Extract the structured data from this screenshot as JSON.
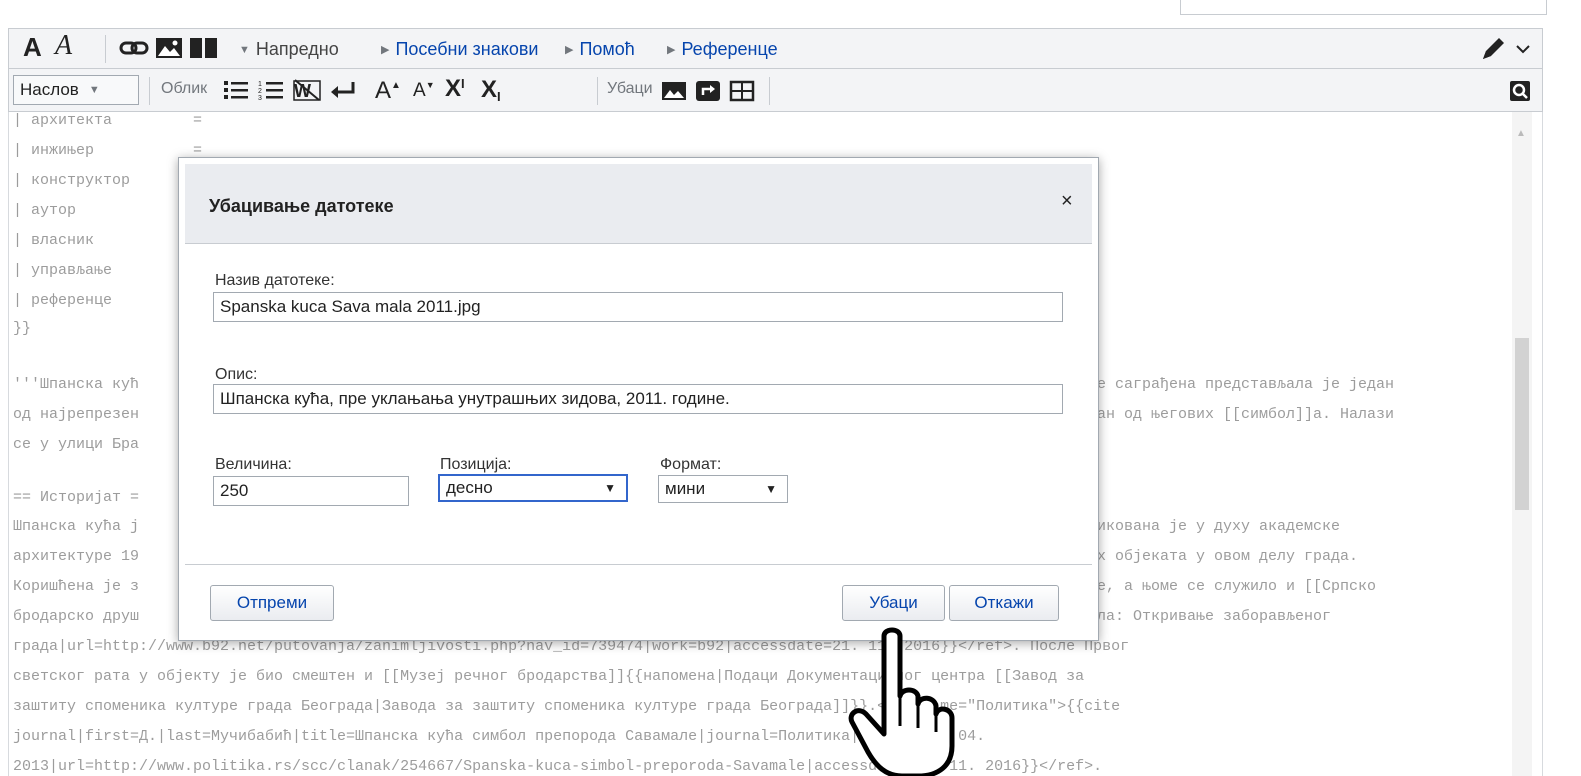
{
  "toolbar_top": {
    "bold_label": "A",
    "italic_label": "A",
    "advanced_label": "Напредно",
    "special_chars_label": "Посебни знакови",
    "help_label": "Помоћ",
    "references_label": "Референце"
  },
  "toolbar_bottom": {
    "heading_select_label": "Наслов",
    "format_label": "Облик",
    "insert_label": "Убаци",
    "superscript_label": "X",
    "superscript_mark": "I",
    "subscript_label": "X",
    "subscript_mark": "I",
    "bigger_label": "A",
    "smaller_label": "A"
  },
  "editor": {
    "lines": [
      "| архитекта         =",
      "| инжињер           =",
      "| конструктор",
      "| аутор",
      "| власник",
      "| управљање",
      "| референце",
      "}}",
      "",
      "'''Шпанска кућ",
      "од најрепрезен",
      "се у улици Бра",
      "",
      "== Историјат =",
      "Шпанска кућа ј",
      "архитектуре 19",
      "Коришћена је з",
      "бродарско друш",
      "града|url=http://www.b92.net/putovanja/zanimljivosti.php?nav_id=739474|work=b92|accessdate=21. 11. 2016}}</ref>. После Првог",
      "светског рата у објекту је био смештен и [[Музеј речног бродарства]]{{напомена|Подаци Документационог центра [[Завод за",
      "заштиту споменика културе града Београда|Завода за заштиту споменика културе града Београда]]}}.<ref name=\"Политика\">{{cite",
      "journal|first=Д.|last=Мучибабић|title=Шпанска кућа симбол препорода Савамале|journal=Политика|date = 12. 04.",
      "2013|url=http://www.politika.rs/scc/clanak/254667/Spanska-kuca-simbol-preporoda-Savamale|accessdate=21. 11. 2016}}</ref>."
    ],
    "right_fragments": [
      "е саграђена представљала је један",
      "ан од његових [[симбол]]а. Налази",
      "икована је у духу академске",
      "х објеката у овом делу града.",
      "е, а њоме се служило и [[Српско",
      "ла: Откривање заборављеног"
    ]
  },
  "dialog": {
    "title": "Убацивање датотеке",
    "close_glyph": "×",
    "filename_label": "Назив датотеке:",
    "filename_value": "Spanska kuca Sava mala 2011.jpg",
    "caption_label": "Опис:",
    "caption_value": "Шпанска кућа, пре уклањања унутрашњих зидова, 2011. године.",
    "size_label": "Величина:",
    "size_value": "250",
    "position_label": "Позиција:",
    "position_value": "десно",
    "format_label": "Формат:",
    "format_value": "мини",
    "upload_button": "Отпреми",
    "insert_button": "Убаци",
    "cancel_button": "Откажи"
  }
}
